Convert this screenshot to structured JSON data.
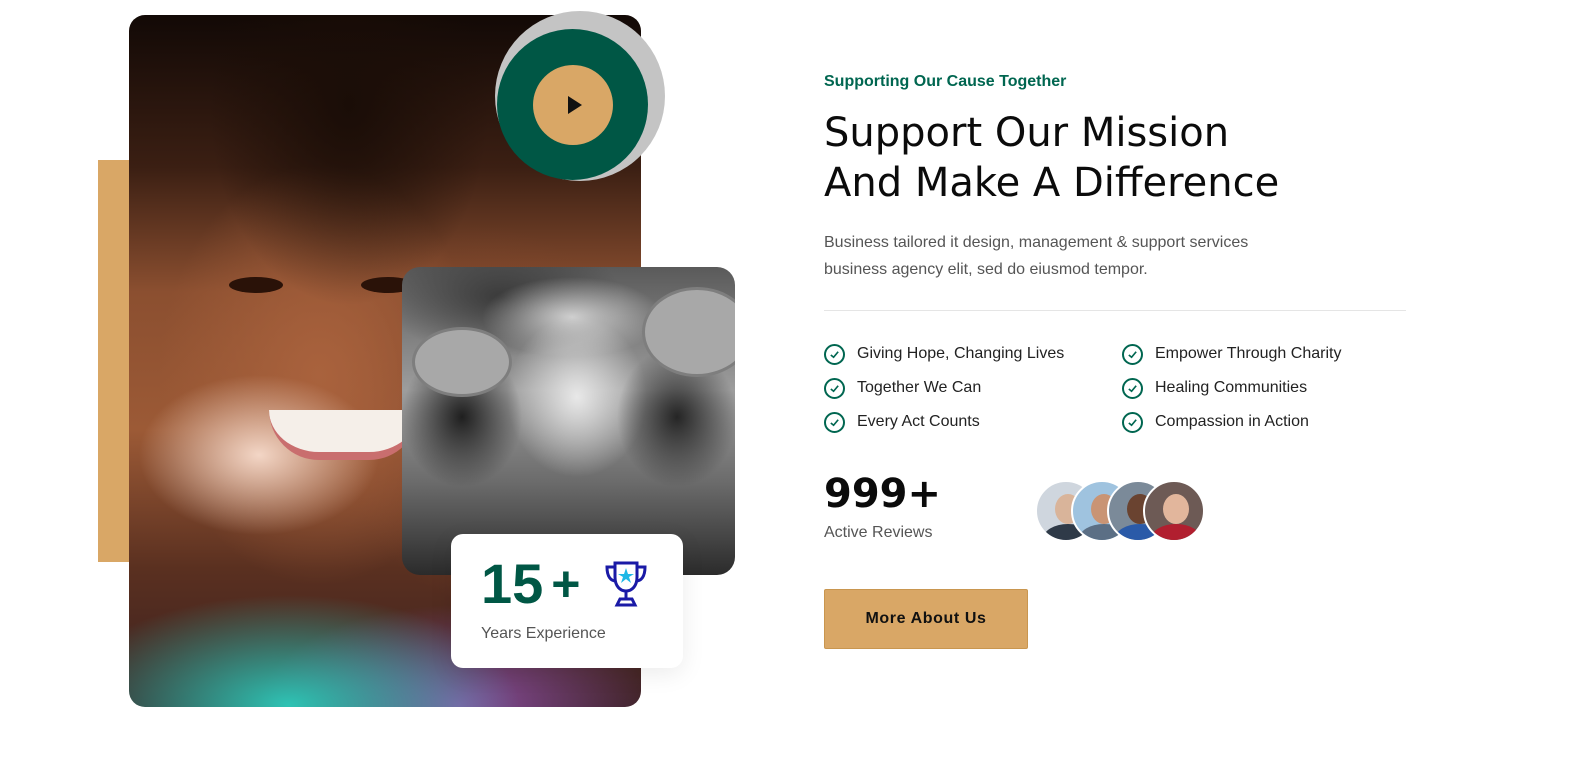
{
  "about": {
    "eyebrow": "Supporting Our Cause Together",
    "headline_line1": "Support Our Mission",
    "headline_line2": "And Make A Difference",
    "description": "Business tailored it design, management & support services business agency elit, sed do eiusmod tempor.",
    "features": [
      {
        "label": "Giving Hope, Changing Lives",
        "icon": "check-circle-icon"
      },
      {
        "label": "Empower Through Charity",
        "icon": "check-circle-icon"
      },
      {
        "label": "Together We Can",
        "icon": "check-circle-icon"
      },
      {
        "label": "Healing Communities",
        "icon": "check-circle-icon"
      },
      {
        "label": "Every Act Counts",
        "icon": "check-circle-icon"
      },
      {
        "label": "Compassion in Action",
        "icon": "check-circle-icon"
      }
    ],
    "stat": {
      "value": "999+",
      "label": "Active Reviews"
    },
    "cta_label": "More About Us"
  },
  "experience": {
    "number": "15",
    "suffix": "+",
    "label": "Years Experience",
    "icon": "trophy-icon"
  },
  "media": {
    "play_icon": "play-icon"
  },
  "colors": {
    "brand_green": "#005745",
    "accent_gold": "#d9a766",
    "text_green": "#006650",
    "trophy_blue": "#1a1aa6"
  }
}
